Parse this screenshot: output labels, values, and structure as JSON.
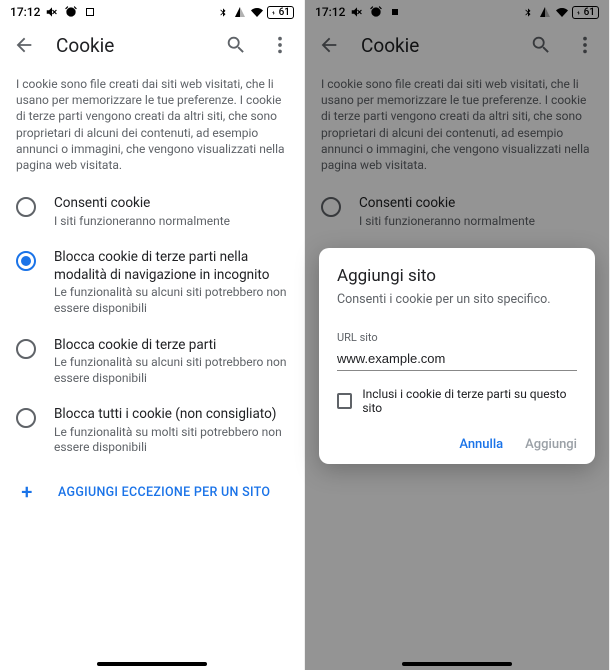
{
  "statusbar": {
    "time": "17:12",
    "battery": "61"
  },
  "header": {
    "title": "Cookie"
  },
  "description": "I cookie sono file creati dai siti web visitati, che li usano per memorizzare le tue preferenze. I cookie di terze parti vengono creati da altri siti, che sono proprietari di alcuni dei contenuti, ad esempio annunci o immagini, che vengono visualizzati nella pagina web visitata.",
  "options": [
    {
      "title": "Consenti cookie",
      "sub": "I siti funzioneranno normalmente",
      "selected": false
    },
    {
      "title": "Blocca cookie di terze parti nella modalità di navigazione in incognito",
      "sub": "Le funzionalità su alcuni siti potrebbero non essere disponibili",
      "selected": true
    },
    {
      "title": "Blocca cookie di terze parti",
      "sub": "Le funzionalità su alcuni siti potrebbero non essere disponibili",
      "selected": false
    },
    {
      "title": "Blocca tutti i cookie (non consigliato)",
      "sub": "Le funzionalità su molti siti potrebbero non essere disponibili",
      "selected": false
    }
  ],
  "add_exception": "AGGIUNGI ECCEZIONE PER UN SITO",
  "modal": {
    "title": "Aggiungi sito",
    "desc": "Consenti i cookie per un sito specifico.",
    "url_label": "URL sito",
    "url_value": "www.example.com",
    "checkbox_label": "Inclusi i cookie di terze parti su questo sito",
    "cancel": "Annulla",
    "add": "Aggiungi"
  }
}
